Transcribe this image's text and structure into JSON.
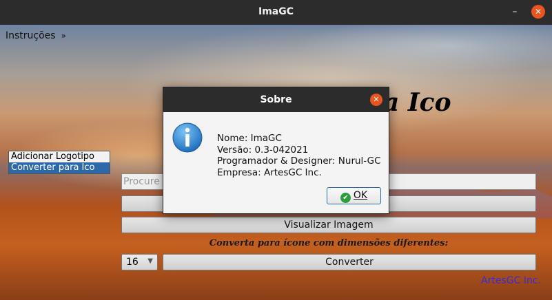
{
  "window": {
    "title": "ImaGC",
    "minimize_glyph": "–",
    "close_glyph": "✕"
  },
  "menubar": {
    "item": "Instruções",
    "more_glyph": "»"
  },
  "main": {
    "heading_fragment": "ra Ico",
    "list_items": [
      "Adicionar Logotipo",
      "Converter para Ico"
    ],
    "search_placeholder": "Procure",
    "visualize_label": "Visualizar Imagem",
    "subtitle": "Converta para ícone com dimensões diferentes:",
    "size_value": "16",
    "convert_label": "Converter",
    "brand": "ArtesGC Inc."
  },
  "dialog": {
    "title": "Sobre",
    "close_glyph": "✕",
    "icon": "info-icon",
    "lines": [
      "Nome: ImaGC",
      "Versão: 0.3-042021",
      "Programador & Designer: Nurul-GC",
      "Empresa: ArtesGC Inc."
    ],
    "ok_label": "OK",
    "ok_icon": "checkmark-icon"
  },
  "colors": {
    "accent": "#e9541f",
    "selection": "#2d69a8",
    "brand": "#3a2bd6",
    "ok_check": "#2e9d3e"
  }
}
